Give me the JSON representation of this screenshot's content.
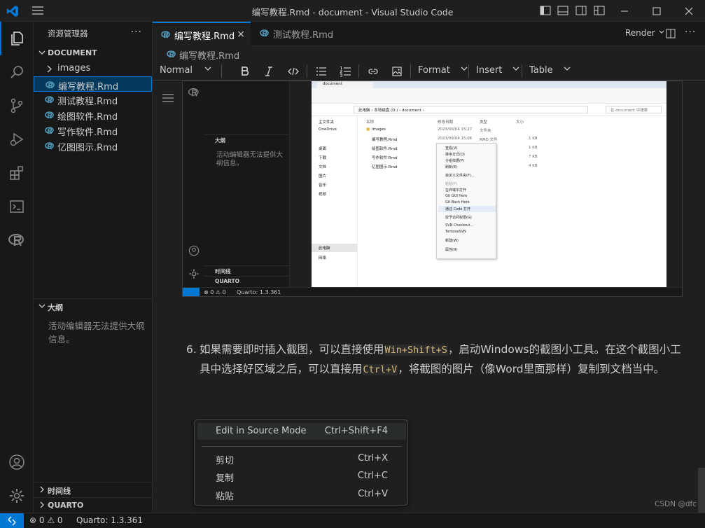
{
  "window": {
    "title": "编写教程.Rmd - document - Visual Studio Code"
  },
  "sidebar": {
    "title": "资源管理器",
    "more": "···",
    "folder": "DOCUMENT",
    "items": [
      {
        "label": "images",
        "type": "folder"
      },
      {
        "label": "编写教程.Rmd",
        "type": "file",
        "selected": true
      },
      {
        "label": "测试教程.Rmd",
        "type": "file"
      },
      {
        "label": "绘图软件.Rmd",
        "type": "file"
      },
      {
        "label": "写作软件.Rmd",
        "type": "file"
      },
      {
        "label": "亿图图示.Rmd",
        "type": "file"
      }
    ],
    "outline_title": "大纲",
    "outline_message": "活动编辑器无法提供大纲信息。",
    "timeline_title": "时间线",
    "quarto_title": "QUARTO"
  },
  "tabs": [
    {
      "label": "编写教程.Rmd",
      "active": true,
      "close": "×"
    },
    {
      "label": "测试教程.Rmd",
      "active": false
    }
  ],
  "render_label": "Render",
  "breadcrumb": "编写教程.Rmd",
  "toolbar": {
    "block_format": "Normal",
    "format": "Format",
    "insert": "Insert",
    "table": "Table"
  },
  "screenshot": {
    "outline_title": "大纲",
    "outline_message": "活动编辑器无法提供大纲信息。",
    "timeline_title": "时间线",
    "quarto_title": "QUARTO",
    "status_problems": "⊗ 0 ⚠ 0",
    "status_quarto": "Quarto: 1.3.361",
    "explorer": {
      "tab": "document",
      "path": "此电脑 › 本地磁盘 (D:) › document ›",
      "search": "在 document 中搜索",
      "nav": [
        "主文件夹",
        "OneDrive",
        "桌面",
        "下载",
        "文档",
        "图片",
        "音乐",
        "视频",
        "此电脑",
        "网络"
      ],
      "headers": {
        "name": "名称",
        "date": "修改日期",
        "type": "类型",
        "size": "大小"
      },
      "rows": [
        {
          "name": "images",
          "date": "2023/09/04 15:27",
          "type": "文件夹",
          "size": ""
        },
        {
          "name": "编写教程.Rmd",
          "date": "2023/09/04 15:06",
          "type": "RMD 文件",
          "size": "1 KB"
        },
        {
          "name": "绘图软件.Rmd",
          "date": "",
          "type": "",
          "size": "1 KB"
        },
        {
          "name": "写作软件.Rmd",
          "date": "",
          "type": "",
          "size": "7 KB"
        },
        {
          "name": "亿图图示.Rmd",
          "date": "",
          "type": "",
          "size": "4 KB"
        }
      ],
      "context": [
        "查看(V)",
        "排序方式(O)",
        "分组依据(P)",
        "刷新(E)",
        "自定义文件夹(F)...",
        "粘贴(P)",
        "在终端中打开",
        "Git GUI Here",
        "Git Bash Here",
        "通过 Code 打开",
        "授予访问权限(G)",
        "SVN Checkout...",
        "TortoiseSVN",
        "新建(W)",
        "属性(R)"
      ]
    }
  },
  "paragraph": {
    "number": "6.",
    "part1": "如果需要即时插入截图，可以直接使用",
    "code1": "Win+Shift+S",
    "part2": "，启动Windows的截图小工具。在这个截图小工具中选择好区域之后，可以直接用",
    "code2": "Ctrl+V",
    "part3": "，将截图的图片（像Word里面那样）复制到文档当中。"
  },
  "context_menu": [
    {
      "label": "Edit in Source Mode",
      "shortcut": "Ctrl+Shift+F4"
    },
    {
      "label": "剪切",
      "shortcut": "Ctrl+X"
    },
    {
      "label": "复制",
      "shortcut": "Ctrl+C"
    },
    {
      "label": "粘贴",
      "shortcut": "Ctrl+V"
    }
  ],
  "watermark": "CSDN @dfc",
  "statusbar": {
    "problems": "⊗ 0 ⚠ 0",
    "quarto": "Quarto: 1.3.361"
  },
  "colors": {
    "accent": "#0078d4",
    "background": "#1f1f1f",
    "sidebar": "#181818",
    "code": "#d7ba7d"
  }
}
